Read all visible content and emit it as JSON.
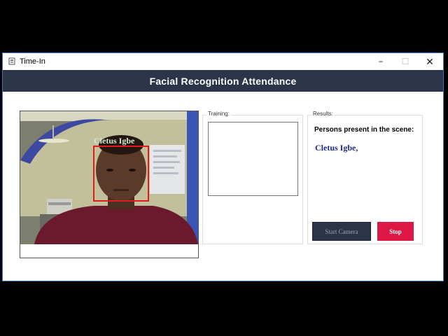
{
  "window": {
    "title": "Time-In",
    "controls": {
      "minimize": "−",
      "maximize": "☐",
      "close": "✕"
    }
  },
  "header": {
    "title": "Facial Recognition Attendance"
  },
  "video": {
    "face_label": "Cletus Igbe"
  },
  "training": {
    "legend": "Training:"
  },
  "results": {
    "legend": "Results:",
    "present_label": "Persons present in the scene:",
    "names": "Cletus Igbe,"
  },
  "buttons": {
    "start": "Start Camera",
    "stop": "Stop"
  },
  "colors": {
    "header_bg": "#2b3448",
    "face_box": "#e01b1b",
    "name_text": "#1f2a8a",
    "stop_button": "#dc1743",
    "start_button": "#2b3448"
  },
  "icons": {
    "app": "app-icon",
    "minimize": "minimize-icon",
    "maximize": "maximize-icon",
    "close": "close-icon"
  }
}
